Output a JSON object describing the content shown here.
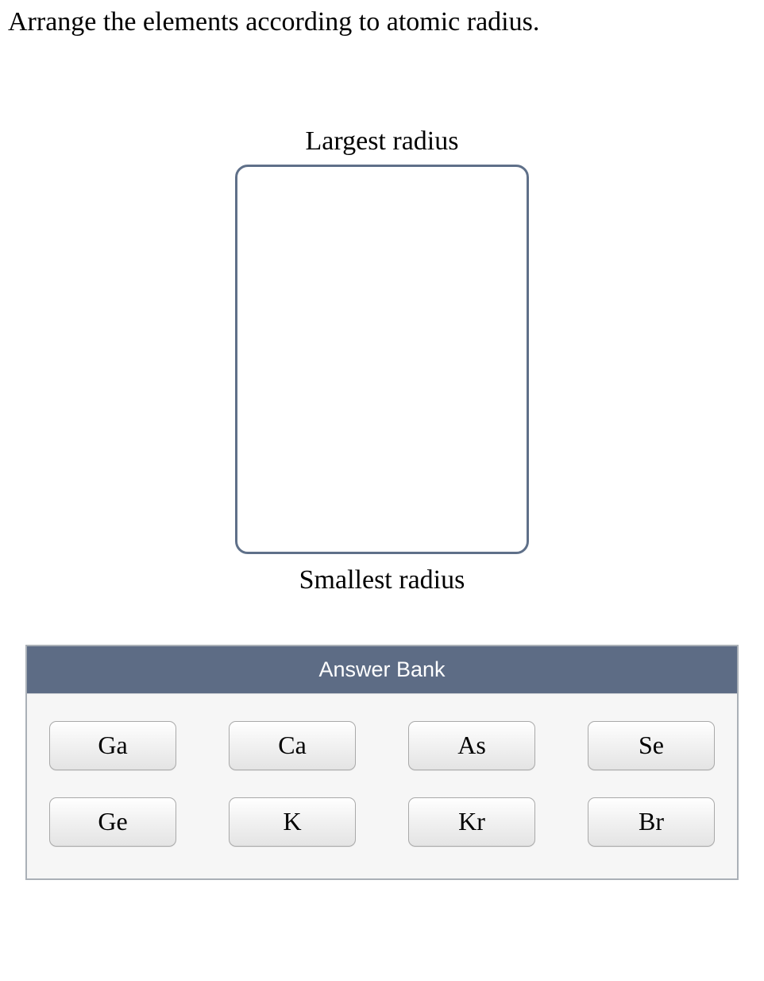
{
  "question": "Arrange the elements according to atomic radius.",
  "ranking": {
    "top_label": "Largest radius",
    "bottom_label": "Smallest radius"
  },
  "answer_bank": {
    "title": "Answer Bank",
    "items": [
      "Ga",
      "Ca",
      "As",
      "Se",
      "Ge",
      "K",
      "Kr",
      "Br"
    ]
  }
}
